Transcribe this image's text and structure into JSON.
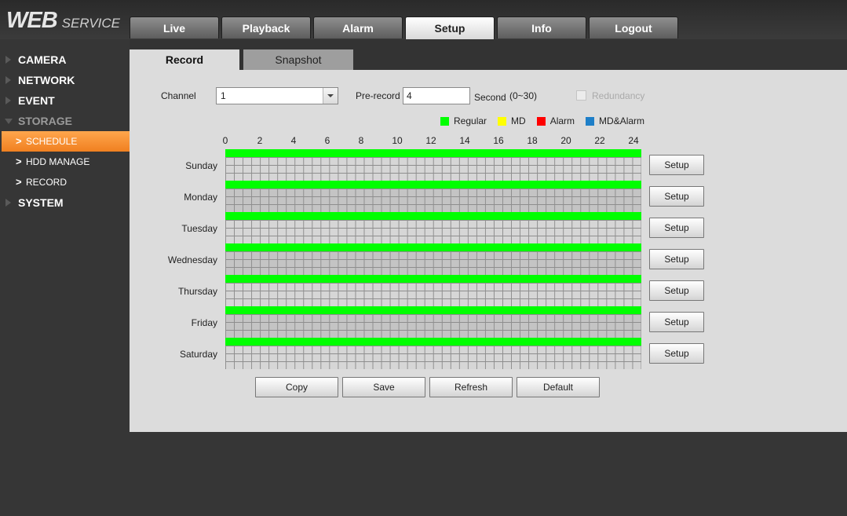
{
  "logo": {
    "main": "WEB",
    "sub": "SERVICE"
  },
  "topnav": [
    "Live",
    "Playback",
    "Alarm",
    "Setup",
    "Info",
    "Logout"
  ],
  "sidebar": {
    "camera": "CAMERA",
    "network": "NETWORK",
    "event": "EVENT",
    "storage": "STORAGE",
    "sub": [
      "SCHEDULE",
      "HDD MANAGE",
      "RECORD"
    ],
    "system": "SYSTEM"
  },
  "subtabs": {
    "record": "Record",
    "snapshot": "Snapshot"
  },
  "form": {
    "channel_label": "Channel",
    "channel_value": "1",
    "prerecord_label": "Pre-record",
    "prerecord_value": "4",
    "second_label": "Second",
    "range_label": "(0~30)",
    "redundancy_label": "Redundancy"
  },
  "legend": [
    {
      "label": "Regular",
      "color": "#00ff00"
    },
    {
      "label": "MD",
      "color": "#ffff00"
    },
    {
      "label": "Alarm",
      "color": "#ff0000"
    },
    {
      "label": "MD&Alarm",
      "color": "#1e7fc8"
    }
  ],
  "hours": [
    "0",
    "2",
    "4",
    "6",
    "8",
    "10",
    "12",
    "14",
    "16",
    "18",
    "20",
    "22",
    "24"
  ],
  "days": [
    "Sunday",
    "Monday",
    "Tuesday",
    "Wednesday",
    "Thursday",
    "Friday",
    "Saturday"
  ],
  "setup_label": "Setup",
  "buttons": {
    "copy": "Copy",
    "save": "Save",
    "refresh": "Refresh",
    "default": "Default"
  }
}
